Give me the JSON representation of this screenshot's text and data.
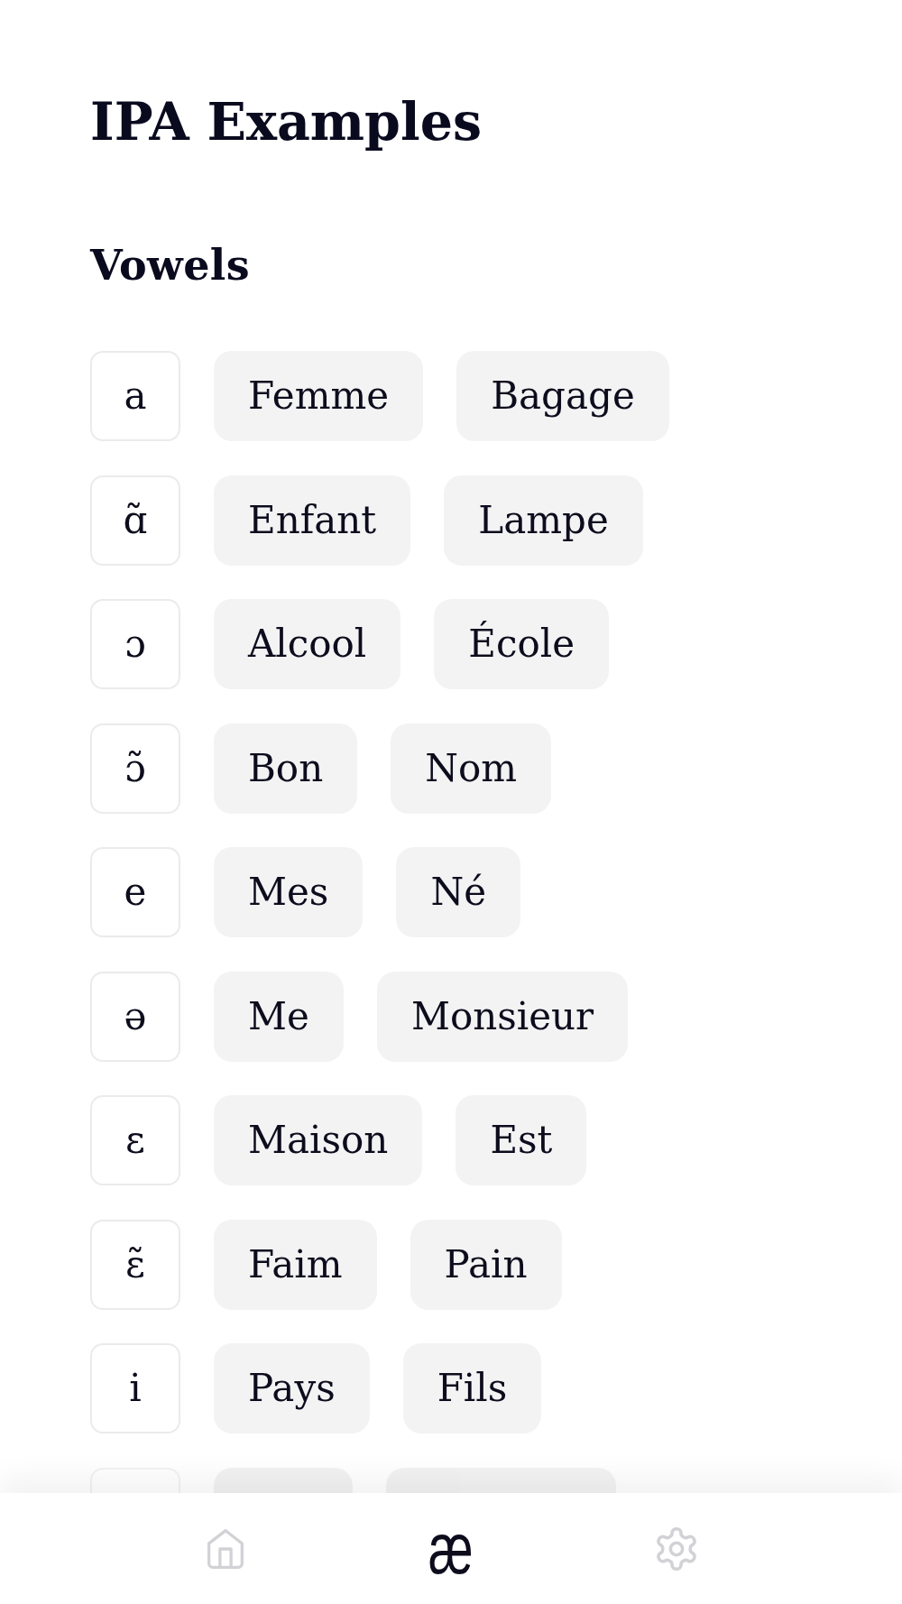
{
  "screen": {
    "title": "IPA Examples"
  },
  "section": {
    "title": "Vowels",
    "rows": [
      {
        "symbol": "a",
        "words": [
          "Femme",
          "Bagage"
        ]
      },
      {
        "symbol": "ɑ̃",
        "words": [
          "Enfant",
          "Lampe"
        ]
      },
      {
        "symbol": "ɔ",
        "words": [
          "Alcool",
          "École"
        ]
      },
      {
        "symbol": "ɔ̃",
        "words": [
          "Bon",
          "Nom"
        ]
      },
      {
        "symbol": "e",
        "words": [
          "Mes",
          "Né"
        ]
      },
      {
        "symbol": "ə",
        "words": [
          "Me",
          "Monsieur"
        ]
      },
      {
        "symbol": "ɛ",
        "words": [
          "Maison",
          "Est"
        ]
      },
      {
        "symbol": "ɛ̃",
        "words": [
          "Faim",
          "Pain"
        ]
      },
      {
        "symbol": "i",
        "words": [
          "Pays",
          "Fils"
        ]
      }
    ],
    "clipped_row": true
  },
  "nav": [
    {
      "kind": "home",
      "selected": false
    },
    {
      "kind": "glyph",
      "label": "æ",
      "selected": true
    },
    {
      "kind": "settings",
      "selected": false
    }
  ]
}
